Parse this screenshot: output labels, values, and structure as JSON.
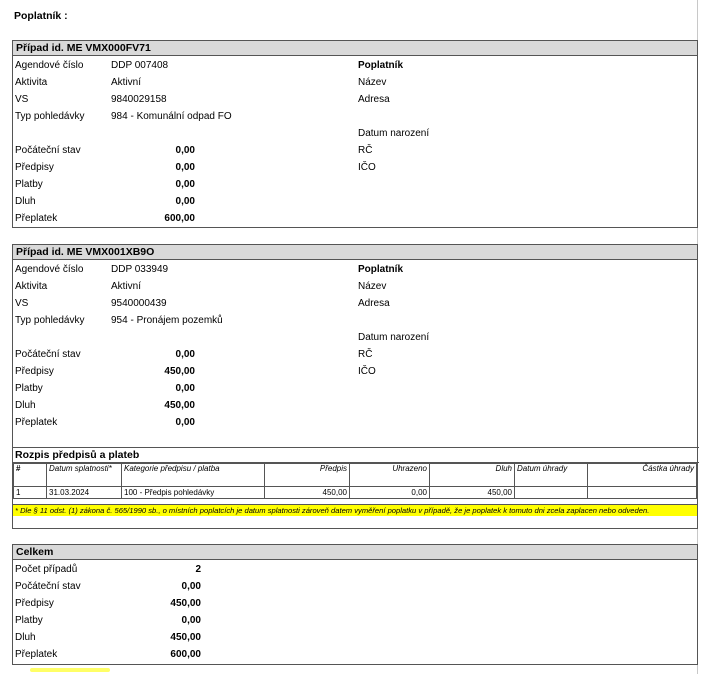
{
  "page": {
    "top_label": "Poplatník :"
  },
  "case1": {
    "title": "Případ id. ME VMX000FV71",
    "rows": [
      {
        "label": "Agendové číslo",
        "value": "DDP 007408"
      },
      {
        "label": "Aktivita",
        "value": "Aktivní"
      },
      {
        "label": "VS",
        "value": "9840029158"
      },
      {
        "label": "Typ pohledávky",
        "value": "984 - Komunální odpad FO"
      }
    ],
    "amounts": [
      {
        "label": "Počáteční stav",
        "value": "0,00"
      },
      {
        "label": "Předpisy",
        "value": "0,00"
      },
      {
        "label": "Platby",
        "value": "0,00"
      },
      {
        "label": "Dluh",
        "value": "0,00"
      },
      {
        "label": "Přeplatek",
        "value": "600,00"
      }
    ],
    "payer": {
      "heading": "Poplatník",
      "name": "Název",
      "address": "Adresa",
      "birth": "Datum narození",
      "rc": "RČ",
      "ico": "IČO"
    }
  },
  "case2": {
    "title": "Případ id. ME VMX001XB9O",
    "rows": [
      {
        "label": "Agendové číslo",
        "value": "DDP 033949"
      },
      {
        "label": "Aktivita",
        "value": "Aktivní"
      },
      {
        "label": "VS",
        "value": "9540000439"
      },
      {
        "label": "Typ pohledávky",
        "value": "954 - Pronájem pozemků"
      }
    ],
    "amounts": [
      {
        "label": "Počáteční stav",
        "value": "0,00"
      },
      {
        "label": "Předpisy",
        "value": "450,00"
      },
      {
        "label": "Platby",
        "value": "0,00"
      },
      {
        "label": "Dluh",
        "value": "450,00"
      },
      {
        "label": "Přeplatek",
        "value": "0,00"
      }
    ],
    "payer": {
      "heading": "Poplatník",
      "name": "Název",
      "address": "Adresa",
      "birth": "Datum narození",
      "rc": "RČ",
      "ico": "IČO"
    },
    "schedule": {
      "title": "Rozpis předpisů a plateb",
      "headers": [
        "#",
        "Datum splatnosti*",
        "Kategorie předpisu / platba",
        "Předpis",
        "Uhrazeno",
        "Dluh",
        "Datum úhrady",
        "Částka úhrady"
      ],
      "rows": [
        [
          "1",
          "31.03.2024",
          "100 - Předpis pohledávky",
          "450,00",
          "0,00",
          "450,00",
          "",
          ""
        ]
      ],
      "footnote": "* Dle § 11 odst. (1) zákona č. 565/1990 sb., o místních poplatcích je datum splatnosti zároveň datem vyměření poplatku v případě, že je poplatek k tomuto dni zcela zaplacen nebo odveden."
    }
  },
  "total": {
    "title": "Celkem",
    "rows": [
      {
        "label": "Počet případů",
        "value": "2"
      },
      {
        "label": "Počáteční stav",
        "value": "0,00"
      },
      {
        "label": "Předpisy",
        "value": "450,00"
      },
      {
        "label": "Platby",
        "value": "0,00"
      },
      {
        "label": "Dluh",
        "value": "450,00"
      },
      {
        "label": "Přeplatek",
        "value": "600,00"
      }
    ]
  }
}
